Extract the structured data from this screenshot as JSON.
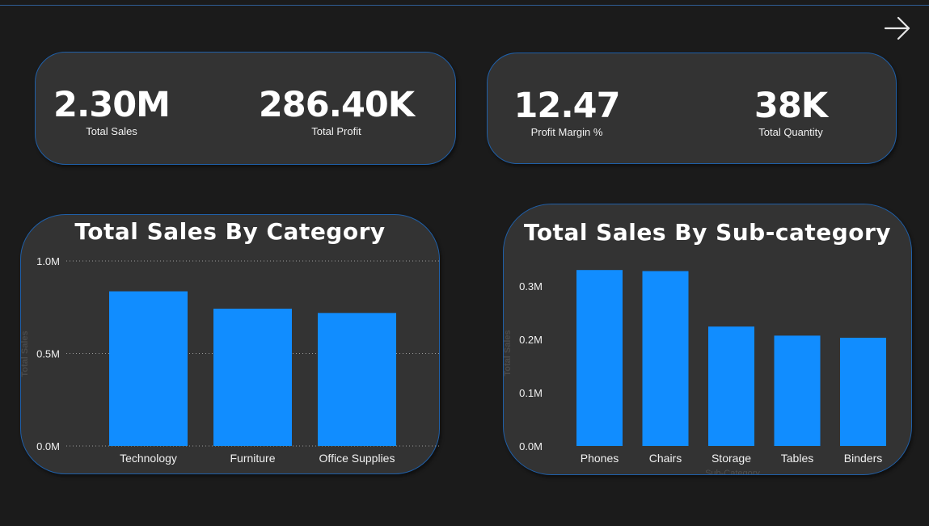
{
  "kpis": {
    "total_sales": {
      "value": "2.30M",
      "label": "Total Sales"
    },
    "total_profit": {
      "value": "286.40K",
      "label": "Total Profit"
    },
    "profit_margin": {
      "value": "12.47",
      "label": "Profit Margin %"
    },
    "total_quantity": {
      "value": "38K",
      "label": "Total Quantity"
    }
  },
  "colors": {
    "background": "#1b1b1b",
    "card": "#333333",
    "card_border": "#1f5fa8",
    "bar": "#118dff",
    "text": "#ffffff"
  },
  "icons": {
    "next_page": "arrow-right-icon"
  },
  "chart_data": [
    {
      "type": "bar",
      "title": "Total Sales By Category",
      "xlabel": "",
      "ylabel": "Total Sales",
      "categories": [
        "Technology",
        "Furniture",
        "Office Supplies"
      ],
      "values": [
        836000,
        742000,
        719000
      ],
      "ylim": [
        0,
        1000000
      ],
      "yticks": [
        0,
        500000,
        1000000
      ],
      "ytick_labels": [
        "0.0M",
        "0.5M",
        "1.0M"
      ],
      "grid": true
    },
    {
      "type": "bar",
      "title": "Total Sales By Sub-category",
      "xlabel": "Sub-Category",
      "ylabel": "Total Sales",
      "categories": [
        "Phones",
        "Chairs",
        "Storage",
        "Tables",
        "Binders"
      ],
      "values": [
        330000,
        328000,
        224000,
        207000,
        203000
      ],
      "ylim": [
        0,
        0.3
      ],
      "yticks": [
        0,
        0.1,
        0.2,
        0.3
      ],
      "ytick_labels": [
        "0.0M",
        "0.1M",
        "0.2M",
        "0.3M"
      ],
      "grid": false
    }
  ]
}
